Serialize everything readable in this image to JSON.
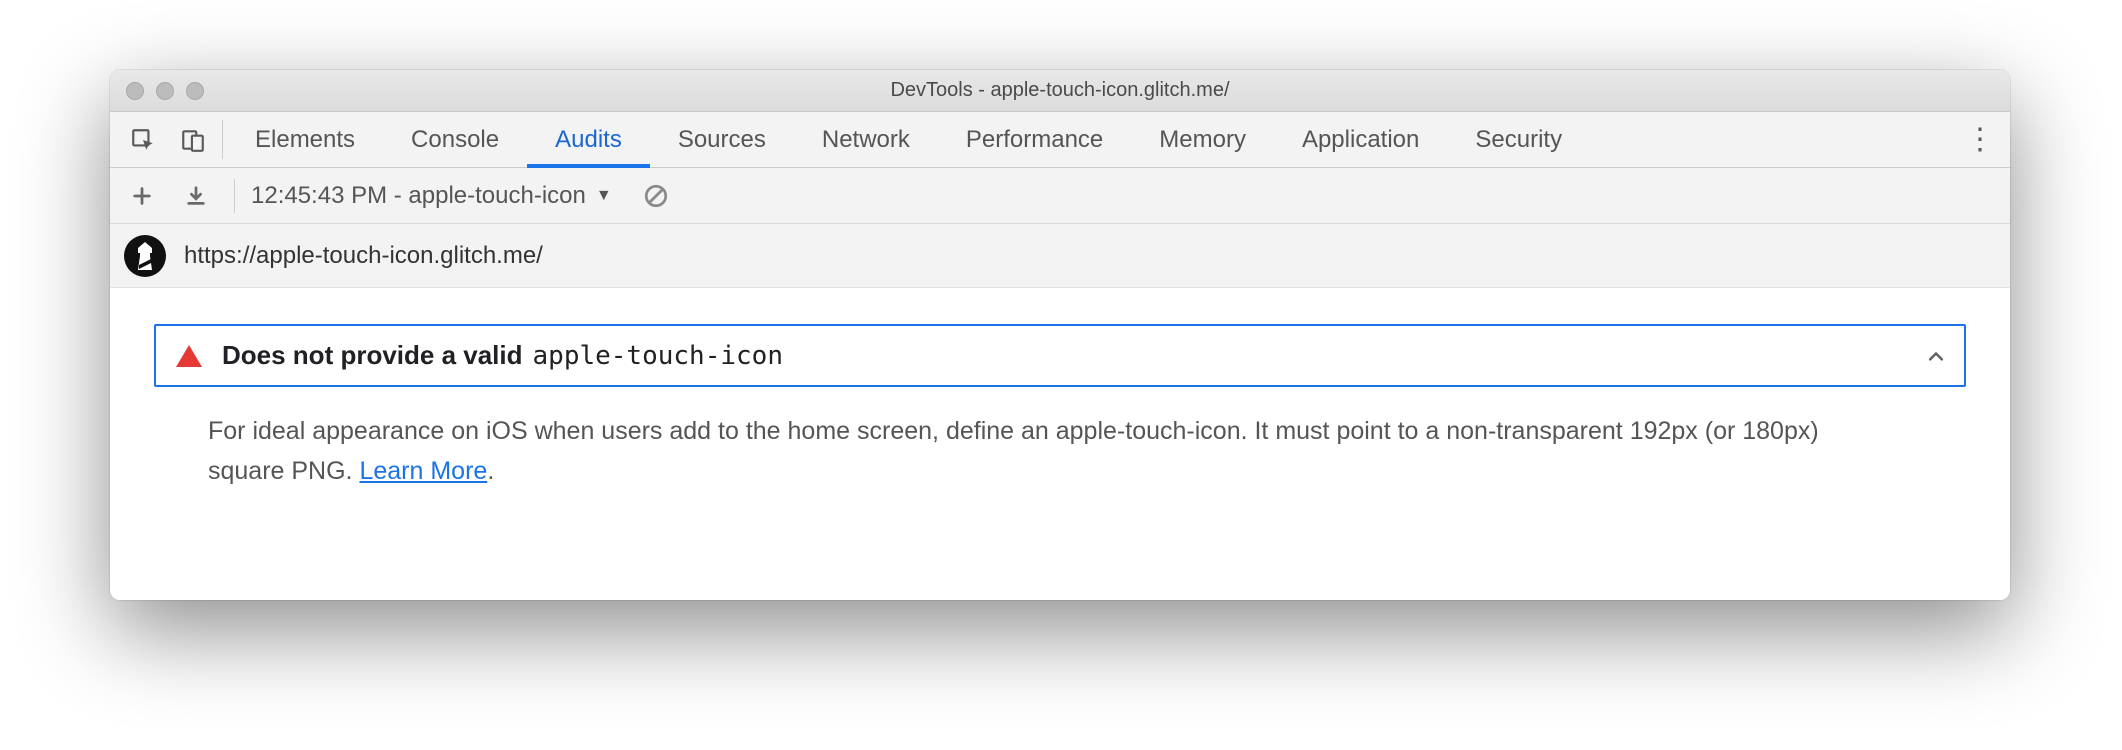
{
  "window": {
    "title": "DevTools - apple-touch-icon.glitch.me/"
  },
  "tabs": [
    {
      "label": "Elements"
    },
    {
      "label": "Console"
    },
    {
      "label": "Audits"
    },
    {
      "label": "Sources"
    },
    {
      "label": "Network"
    },
    {
      "label": "Performance"
    },
    {
      "label": "Memory"
    },
    {
      "label": "Application"
    },
    {
      "label": "Security"
    }
  ],
  "active_tab_index": 2,
  "toolbar": {
    "report_label": "12:45:43 PM - apple-touch-icon"
  },
  "urlrow": {
    "url": "https://apple-touch-icon.glitch.me/"
  },
  "audit": {
    "title_prefix": "Does not provide a valid ",
    "title_code": "apple-touch-icon",
    "description_pre": "For ideal appearance on iOS when users add to the home screen, define an apple-touch-icon. It must point to a non-transparent 192px (or 180px) square PNG. ",
    "learn_more_label": "Learn More",
    "description_post": "."
  }
}
